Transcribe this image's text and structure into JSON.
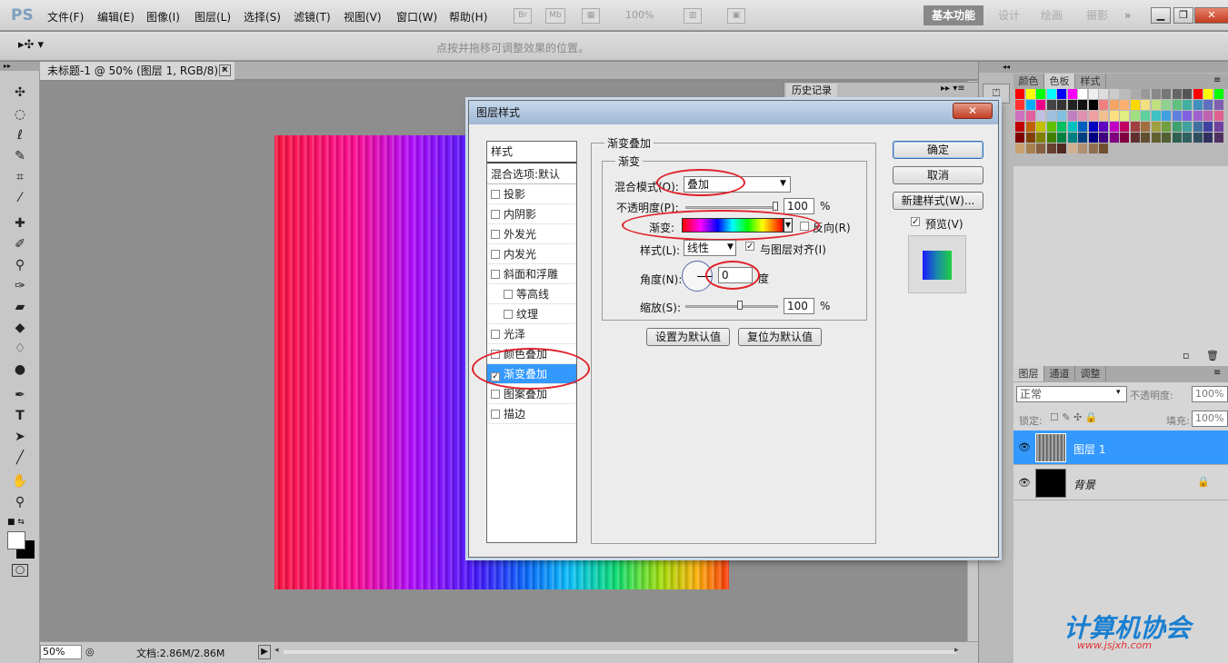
{
  "app": {
    "logo": "PS"
  },
  "menu": [
    "文件(F)",
    "编辑(E)",
    "图像(I)",
    "图层(L)",
    "选择(S)",
    "滤镜(T)",
    "视图(V)",
    "窗口(W)",
    "帮助(H)"
  ],
  "toolbar_icons": {
    "br": "Br",
    "mb": "Mb",
    "zoom": "100%"
  },
  "workspaces": [
    "基本功能",
    "设计",
    "绘画",
    "摄影"
  ],
  "options_hint": "点按并拖移可调整效果的位置。",
  "document": {
    "tab_title": "未标题-1 @ 50% (图层 1, RGB/8) *"
  },
  "status": {
    "zoom": "50%",
    "doc_size": "文档:2.86M/2.86M"
  },
  "history": {
    "tab": "历史记录"
  },
  "swatch_panel": {
    "tabs": [
      "颜色",
      "色板",
      "样式"
    ]
  },
  "layers_panel": {
    "tabs": [
      "图层",
      "通道",
      "调整"
    ],
    "blend_mode": "正常",
    "opacity_label": "不透明度:",
    "opacity_value": "100%",
    "lock_label": "锁定:",
    "fill_label": "填充:",
    "fill_value": "100%",
    "layers": [
      {
        "name": "图层 1"
      },
      {
        "name": "背景"
      }
    ]
  },
  "dialog": {
    "title": "图层样式",
    "close": "✕",
    "style_header": "样式",
    "blend_options": "混合选项:默认",
    "styles": [
      {
        "label": "投影",
        "checked": false
      },
      {
        "label": "内阴影",
        "checked": false
      },
      {
        "label": "外发光",
        "checked": false
      },
      {
        "label": "内发光",
        "checked": false
      },
      {
        "label": "斜面和浮雕",
        "checked": false
      },
      {
        "label": "等高线",
        "checked": false
      },
      {
        "label": "纹理",
        "checked": false
      },
      {
        "label": "光泽",
        "checked": false
      },
      {
        "label": "颜色叠加",
        "checked": false
      },
      {
        "label": "渐变叠加",
        "checked": true
      },
      {
        "label": "图案叠加",
        "checked": false
      },
      {
        "label": "描边",
        "checked": false
      }
    ],
    "group_title": "渐变叠加",
    "sub_title": "渐变",
    "blend_mode_label": "混合模式(O):",
    "blend_mode_value": "叠加",
    "opacity_label": "不透明度(P):",
    "opacity_value": "100",
    "pct": "%",
    "gradient_label": "渐变:",
    "reverse_label": "反向(R)",
    "style_label": "样式(L):",
    "style_value": "线性",
    "align_label": "与图层对齐(I)",
    "angle_label": "角度(N):",
    "angle_value": "0",
    "angle_unit": "度",
    "scale_label": "缩放(S):",
    "scale_value": "100",
    "set_default": "设置为默认值",
    "reset_default": "复位为默认值",
    "ok": "确定",
    "cancel": "取消",
    "new_style": "新建样式(W)...",
    "preview_label": "预览(V)"
  },
  "watermark": {
    "text": "计算机协会",
    "url": "www.jsjxh.com"
  },
  "colors": {
    "selection": "#3399ff",
    "annotation": "#e0222a"
  }
}
